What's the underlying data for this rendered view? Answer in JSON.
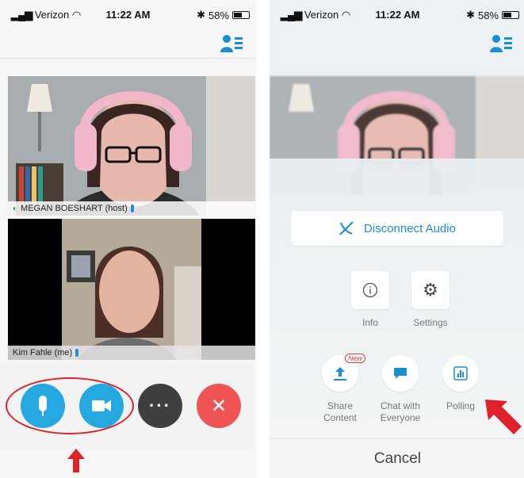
{
  "left_screen": {
    "status": {
      "carrier": "Verizon",
      "time": "11:22 AM",
      "battery": "58%",
      "battery_level": 0.58
    },
    "participants": [
      {
        "name": "MEGAN BOESHART (host)"
      },
      {
        "name": "Kim Fahle (me)"
      }
    ],
    "controls": {
      "mute_icon": "microphone-icon",
      "video_icon": "video-camera-icon",
      "more_label": "···",
      "leave_label": "✕"
    },
    "annotation_color": "#e0202a"
  },
  "right_screen": {
    "status": {
      "carrier": "Verizon",
      "time": "11:22 AM",
      "battery": "58%",
      "battery_level": 0.58
    },
    "disconnect_audio": "Disconnect Audio",
    "options_row1": [
      {
        "label": "Info",
        "icon": "info-icon"
      },
      {
        "label": "Settings",
        "icon": "gear-icon"
      }
    ],
    "options_row2": [
      {
        "label_line1": "Share",
        "label_line2": "Content",
        "icon": "share-upload-icon",
        "badge": "New"
      },
      {
        "label_line1": "Chat with",
        "label_line2": "Everyone",
        "icon": "chat-bubble-icon"
      },
      {
        "label_line1": "Polling",
        "label_line2": "",
        "icon": "bar-chart-icon"
      }
    ],
    "cancel_label": "Cancel"
  },
  "colors": {
    "accent_blue": "#26a8e0",
    "leave_red": "#f05555",
    "link_blue": "#1a8fd0"
  }
}
